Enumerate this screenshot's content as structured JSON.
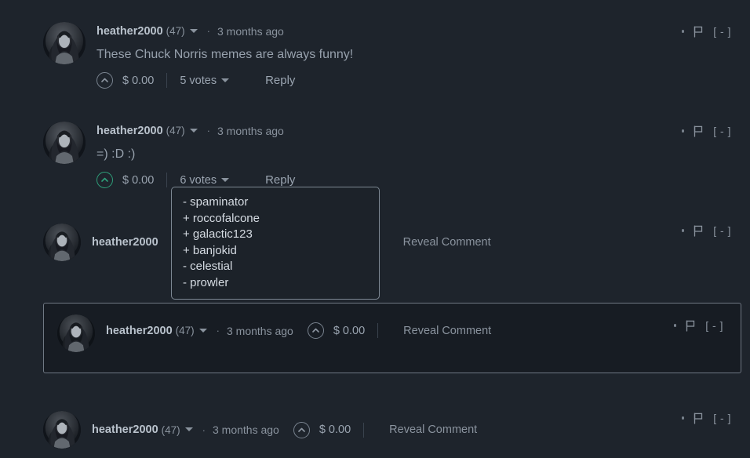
{
  "theme": {
    "background": "#1e242c",
    "text_primary": "#b9c2cc",
    "text_secondary": "#9aa4b0",
    "text_muted": "#8a939e",
    "accent_upvote": "#2e9e79",
    "border_highlight": "#6f7883",
    "dropdown_background": "#1c2229",
    "dropdown_border": "#7d8893"
  },
  "comments": [
    {
      "id": "comment-1",
      "author": "heather2000",
      "reputation": "(47)",
      "separator": "·",
      "timestamp": "3 months ago",
      "body": "These Chuck Norris memes are always funny!",
      "payout": "$ 0.00",
      "votes": "5 votes",
      "reply_label": "Reply",
      "upvote_active": false,
      "collapse_label": "[ - ]",
      "revealed": true
    },
    {
      "id": "comment-2",
      "author": "heather2000",
      "reputation": "(47)",
      "separator": "·",
      "timestamp": "3 months ago",
      "body": "=) :D :)",
      "payout": "$ 0.00",
      "votes": "6 votes",
      "reply_label": "Reply",
      "upvote_active": true,
      "collapse_label": "[ - ]",
      "revealed": true
    },
    {
      "id": "comment-3",
      "author": "heather2000",
      "reveal_label": "Reveal Comment",
      "collapse_label": "[ - ]",
      "revealed": false
    },
    {
      "id": "comment-4",
      "author": "heather2000",
      "reputation": "(47)",
      "separator": "·",
      "timestamp": "3 months ago",
      "payout": "$ 0.00",
      "reveal_label": "Reveal Comment",
      "collapse_label": "[ - ]",
      "upvote_active": false,
      "revealed": false,
      "highlighted": true
    },
    {
      "id": "comment-5",
      "author": "heather2000",
      "reputation": "(47)",
      "separator": "·",
      "timestamp": "3 months ago",
      "payout": "$ 0.00",
      "reveal_label": "Reveal Comment",
      "collapse_label": "[ - ]",
      "upvote_active": false,
      "revealed": false
    }
  ],
  "votes_dropdown": {
    "open": true,
    "belongs_to": "comment-2",
    "entries": [
      "- spaminator",
      "+ roccofalcone",
      "+ galactic123",
      "+ banjokid",
      "- celestial",
      "- prowler"
    ]
  }
}
